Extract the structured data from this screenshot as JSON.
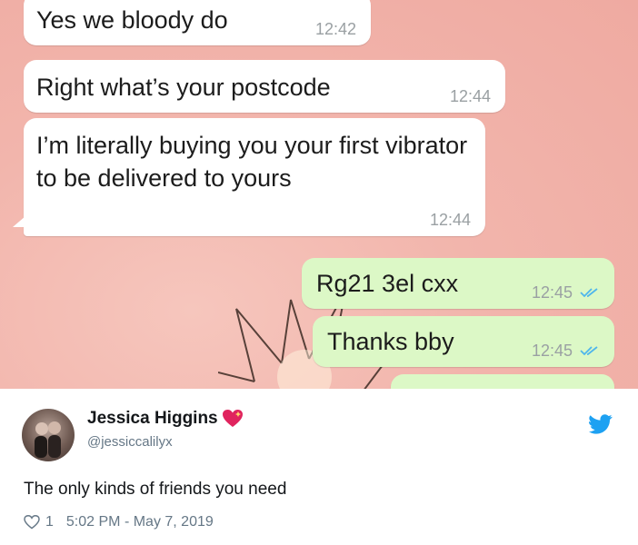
{
  "chat": {
    "messages": [
      {
        "text": "Yes we bloody do",
        "time": "12:42",
        "direction": "incoming"
      },
      {
        "text": "Right what’s your postcode",
        "time": "12:44",
        "direction": "incoming"
      },
      {
        "text": "I’m literally buying you your first vibrator to be delivered to yours",
        "time": "12:44",
        "direction": "incoming"
      },
      {
        "text": "Rg21 3el cxx",
        "time": "12:45",
        "direction": "outgoing",
        "status": "read"
      },
      {
        "text": "Thanks bby",
        "time": "12:45",
        "direction": "outgoing",
        "status": "read"
      }
    ],
    "colors": {
      "background": "#f2b5ac",
      "incoming": "#ffffff",
      "outgoing": "#dcf8c6",
      "read_ticks": "#4fb6ec"
    }
  },
  "tweet": {
    "display_name": "Jessica Higgins",
    "handle": "@jessiccalilyx",
    "text": "The only kinds of friends you need",
    "likes": "1",
    "datetime": "5:02 PM - May 7, 2019",
    "icons": {
      "name_emoji": "sparkling-heart-icon",
      "brand": "twitter-bird-icon",
      "like": "heart-outline-icon"
    },
    "colors": {
      "brand": "#1da1f2",
      "heart": "#e0245e"
    }
  }
}
